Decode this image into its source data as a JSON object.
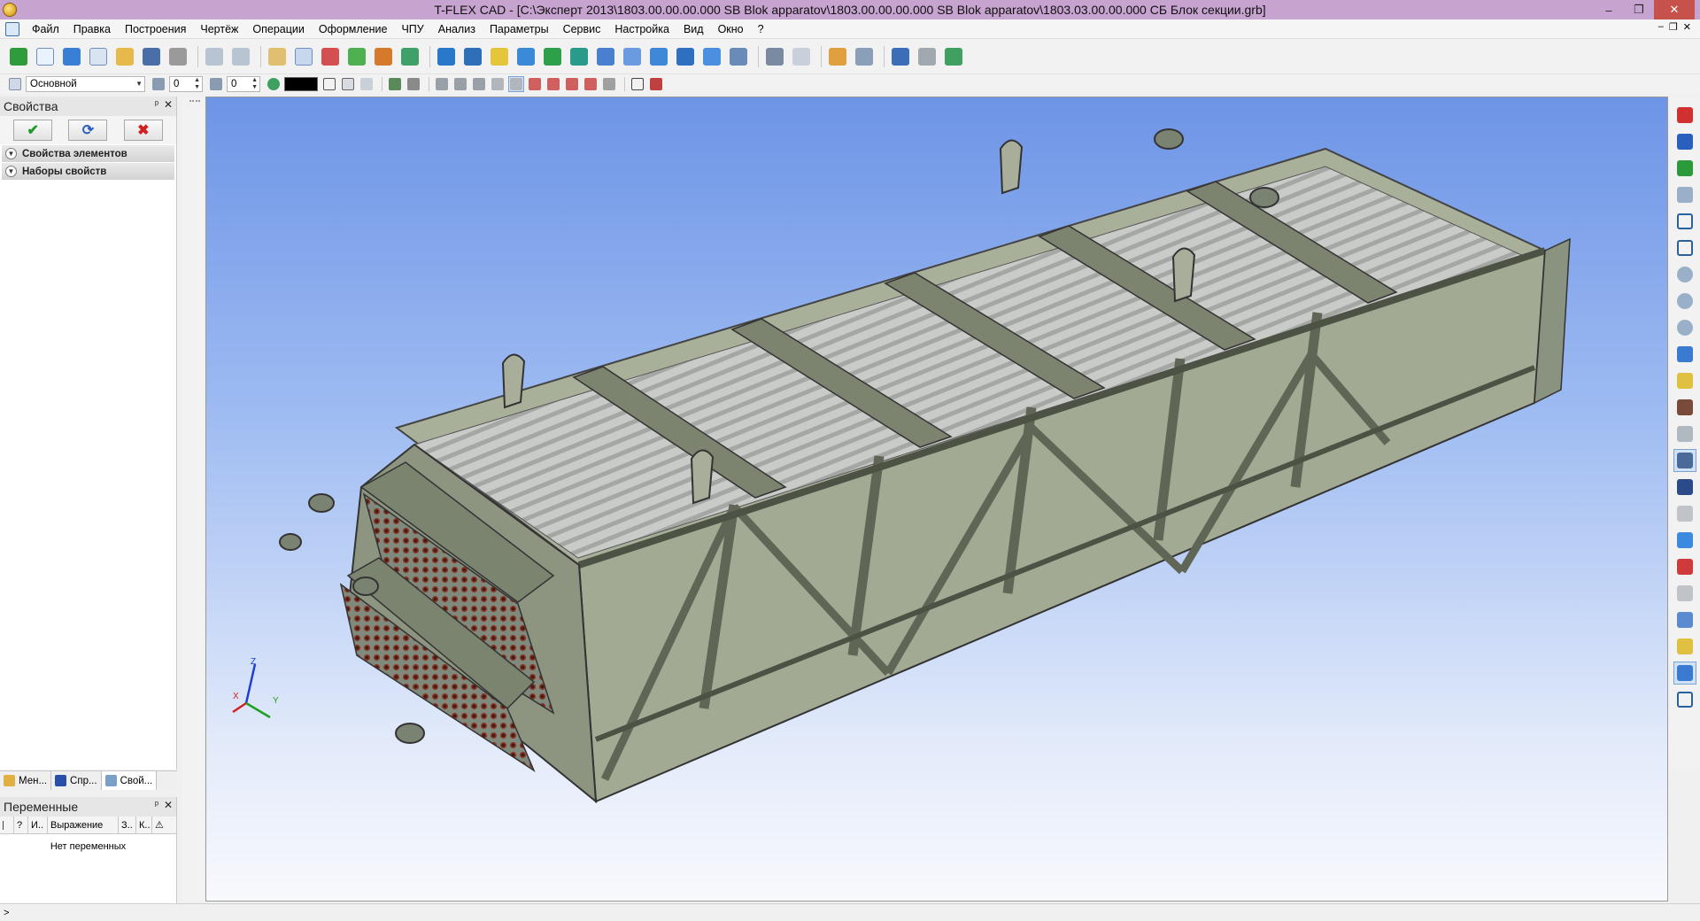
{
  "window": {
    "title": "T-FLEX CAD - [C:\\Эксперт 2013\\1803.00.00.00.000 SB Blok apparatov\\1803.00.00.00.000 SB Blok apparatov\\1803.03.00.00.000 СБ Блок секции.grb]",
    "minimize": "–",
    "maximize": "❐",
    "close": "✕"
  },
  "menu": {
    "items": [
      "Файл",
      "Правка",
      "Построения",
      "Чертёж",
      "Операции",
      "Оформление",
      "ЧПУ",
      "Анализ",
      "Параметры",
      "Сервис",
      "Настройка",
      "Вид",
      "Окно",
      "?"
    ],
    "mdi_minimize": "–",
    "mdi_restore": "❐",
    "mdi_close": "✕"
  },
  "toolbar2": {
    "layer": "Основной",
    "level_value": "0",
    "priority_value": "0"
  },
  "properties_panel": {
    "title": "Свойства",
    "pin": "ᵖ",
    "close": "✕",
    "ok": "✔",
    "refresh": "⟳",
    "cancel": "✖",
    "sections": [
      "Свойства элементов",
      "Наборы свойств"
    ]
  },
  "tabs": [
    "Мен...",
    "Спр...",
    "Свой..."
  ],
  "variables_panel": {
    "title": "Переменные",
    "columns": [
      "?",
      "И..",
      "Выражение",
      "З..",
      "К.."
    ],
    "empty_text": "Нет переменных"
  },
  "axes": {
    "z": "Z",
    "x": "X",
    "y": "Y"
  },
  "status": ">",
  "colors": {
    "title_bar": "#c7a3d0",
    "viewport_top": "#6d94e6",
    "model_green": "#9aa48a",
    "close_button": "#c7514b"
  }
}
